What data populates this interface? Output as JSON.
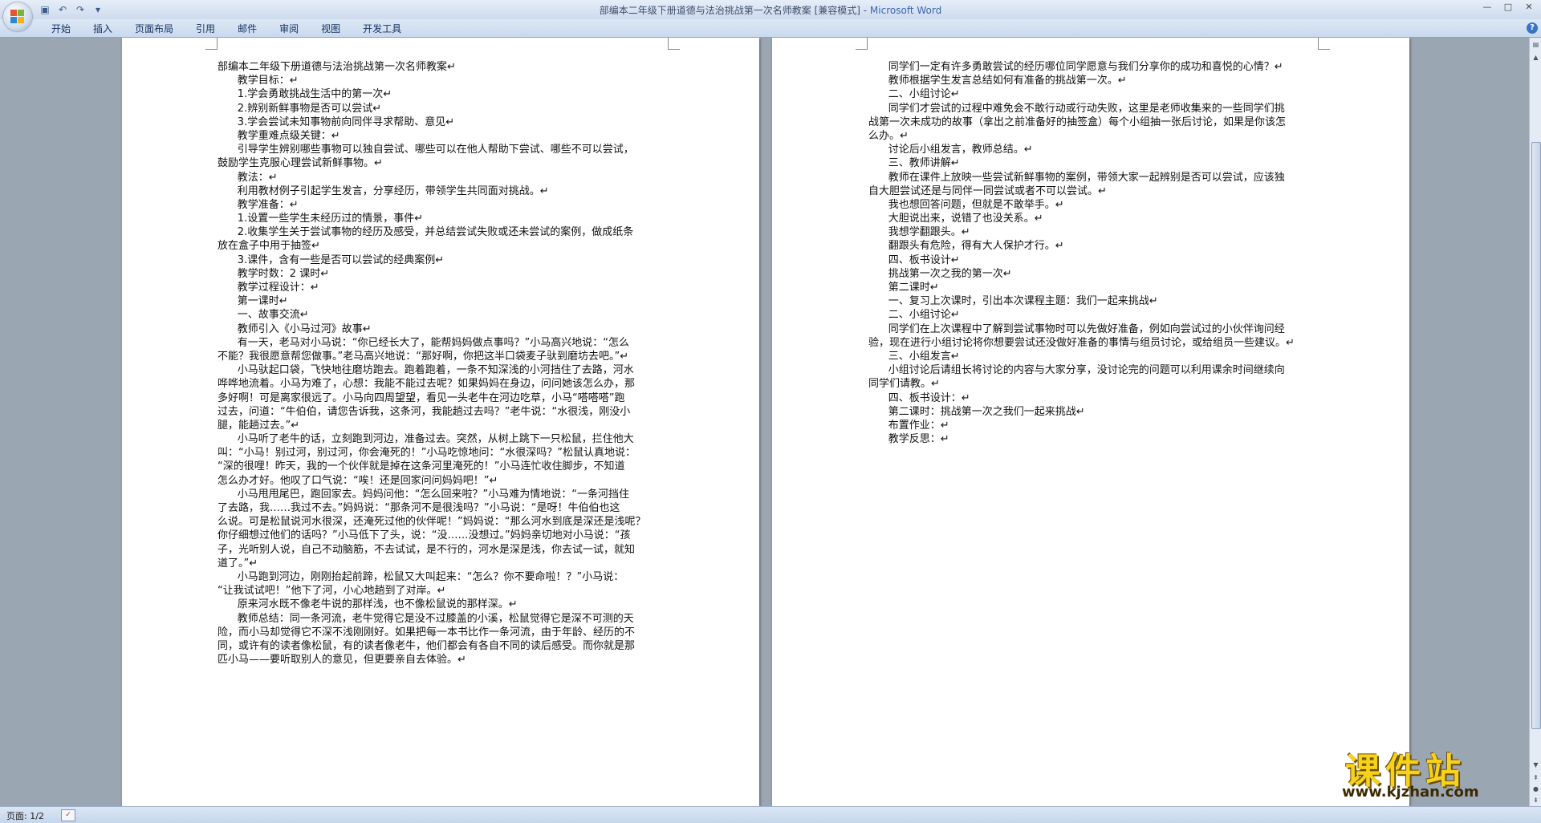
{
  "window": {
    "title": "部编本二年级下册道德与法治挑战第一次名师教案 [兼容模式] - ",
    "app_name": "Microsoft Word",
    "controls": [
      "—",
      "□",
      "✕"
    ]
  },
  "qat": {
    "icons": [
      "save-icon",
      "undo-icon",
      "redo-icon",
      "customize-icon"
    ],
    "glyphs": [
      "▣",
      "↶",
      "↷",
      "▾"
    ]
  },
  "ribbon": {
    "tabs": [
      "开始",
      "插入",
      "页面布局",
      "引用",
      "邮件",
      "审阅",
      "视图",
      "开发工具"
    ],
    "help": "?"
  },
  "page1": {
    "lines": [
      "部编本二年级下册道德与法治挑战第一次名师教案↵",
      "      教学目标：↵",
      "      1.学会勇敢挑战生活中的第一次↵",
      "      2.辨别新鲜事物是否可以尝试↵",
      "      3.学会尝试未知事物前向同伴寻求帮助、意见↵",
      "      教学重难点级关键：↵",
      "      引导学生辨别哪些事物可以独自尝试、哪些可以在他人帮助下尝试、哪些不可以尝试，",
      "鼓励学生克服心理尝试新鲜事物。↵",
      "      教法：↵",
      "      利用教材例子引起学生发言，分享经历，带领学生共同面对挑战。↵",
      "      教学准备：↵",
      "      1.设置一些学生未经历过的情景，事件↵",
      "      2.收集学生关于尝试事物的经历及感受，并总结尝试失败或还未尝试的案例，做成纸条",
      "放在盒子中用于抽签↵",
      "      3.课件，含有一些是否可以尝试的经典案例↵",
      "      教学时数：2 课时↵",
      "      教学过程设计：↵",
      "      第一课时↵",
      "      一、故事交流↵",
      "      教师引入《小马过河》故事↵",
      "      有一天，老马对小马说：“你已经长大了，能帮妈妈做点事吗？”小马高兴地说：“怎么",
      "不能？我很愿意帮您做事。”老马高兴地说：“那好啊，你把这半口袋麦子驮到磨坊去吧。”↵",
      "      小马驮起口袋，飞快地往磨坊跑去。跑着跑着，一条不知深浅的小河挡住了去路，河水",
      "哗哗地流着。小马为难了，心想：我能不能过去呢？如果妈妈在身边，问问她该怎么办，那",
      "多好啊！可是离家很远了。小马向四周望望，看见一头老牛在河边吃草，小马“嗒嗒嗒”跑",
      "过去，问道：“牛伯伯，请您告诉我，这条河，我能趟过去吗？”老牛说：“水很浅，刚没小",
      "腿，能趟过去。”↵",
      "      小马听了老牛的话，立刻跑到河边，准备过去。突然，从树上跳下一只松鼠，拦住他大",
      "叫：“小马！别过河，别过河，你会淹死的！”小马吃惊地问：“水很深吗？”松鼠认真地说：",
      "“深的很哩！昨天，我的一个伙伴就是掉在这条河里淹死的！”小马连忙收住脚步，不知道",
      "怎么办才好。他叹了口气说：“唉！还是回家问问妈妈吧！”↵",
      "      小马甩甩尾巴，跑回家去。妈妈问他：“怎么回来啦？”小马难为情地说：“一条河挡住",
      "了去路，我……我过不去。”妈妈说：“那条河不是很浅吗？”小马说：“是呀！牛伯伯也这",
      "么说。可是松鼠说河水很深，还淹死过他的伙伴呢！”妈妈说：“那么河水到底是深还是浅呢？",
      "你仔细想过他们的话吗？”小马低下了头，说：“没……没想过。”妈妈亲切地对小马说：“孩",
      "子，光听别人说，自己不动脑筋，不去试试，是不行的，河水是深是浅，你去试一试，就知",
      "道了。”↵",
      "      小马跑到河边，刚刚抬起前蹄，松鼠又大叫起来：“怎么？你不要命啦！？”小马说：",
      "“让我试试吧！”他下了河，小心地趟到了对岸。↵",
      "      原来河水既不像老牛说的那样浅，也不像松鼠说的那样深。↵",
      "      教师总结：同一条河流，老牛觉得它是没不过膝盖的小溪，松鼠觉得它是深不可测的天",
      "险，而小马却觉得它不深不浅刚刚好。如果把每一本书比作一条河流，由于年龄、经历的不",
      "同，或许有的读者像松鼠，有的读者像老牛，他们都会有各自不同的读后感受。而你就是那",
      "匹小马——要听取别人的意见，但更要亲自去体验。↵"
    ]
  },
  "page2": {
    "lines": [
      "      同学们一定有许多勇敢尝试的经历哪位同学愿意与我们分享你的成功和喜悦的心情？↵",
      "      教师根据学生发言总结如何有准备的挑战第一次。↵",
      "      二、小组讨论↵",
      "      同学们才尝试的过程中难免会不敢行动或行动失败，这里是老师收集来的一些同学们挑",
      "战第一次未成功的故事（拿出之前准备好的抽签盒）每个小组抽一张后讨论，如果是你该怎",
      "么办。↵",
      "      讨论后小组发言，教师总结。↵",
      "      三、教师讲解↵",
      "      教师在课件上放映一些尝试新鲜事物的案例，带领大家一起辨别是否可以尝试，应该独",
      "自大胆尝试还是与同伴一同尝试或者不可以尝试。↵",
      "      我也想回答问题，但就是不敢举手。↵",
      "      大胆说出来，说错了也没关系。↵",
      "      我想学翻跟头。↵",
      "      翻跟头有危险，得有大人保护才行。↵",
      "      四、板书设计↵",
      "      挑战第一次之我的第一次↵",
      "      第二课时↵",
      "      一、复习上次课时，引出本次课程主题：我们一起来挑战↵",
      "      二、小组讨论↵",
      "      同学们在上次课程中了解到尝试事物时可以先做好准备，例如向尝试过的小伙伴询问经",
      "验，现在进行小组讨论将你想要尝试还没做好准备的事情与组员讨论，或给组员一些建议。↵",
      "      三、小组发言↵",
      "      小组讨论后请组长将讨论的内容与大家分享，没讨论完的问题可以利用课余时间继续向",
      "同学们请教。↵",
      "      四、板书设计：↵",
      "      第二课时：挑战第一次之我们一起来挑战↵",
      "      布置作业：↵",
      "      教学反思：↵"
    ]
  },
  "statusbar": {
    "page": "页面: 1/2"
  },
  "watermark": {
    "title": "课件站",
    "url": "www.kjzhan.com"
  },
  "colors": {
    "window_bg": "#9ba6b3",
    "ribbon": "#dde8f5",
    "accent": "#3a66b0",
    "watermark": "#f6d21c"
  }
}
